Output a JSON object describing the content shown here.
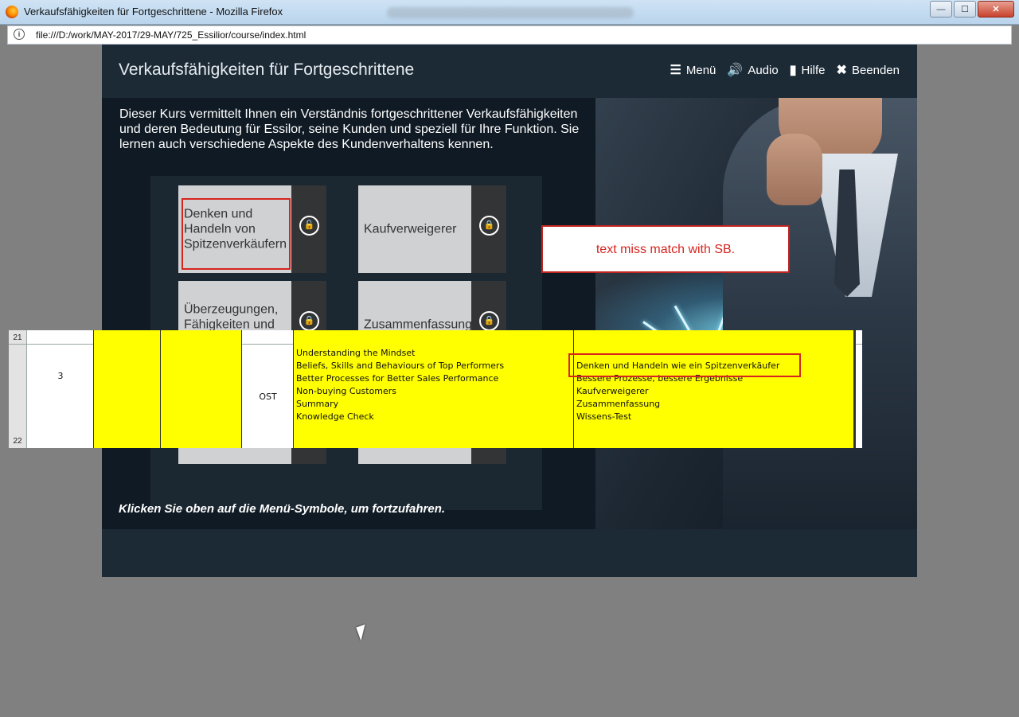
{
  "browser": {
    "title": "Verkaufsfähigkeiten für Fortgeschrittene - Mozilla Firefox",
    "url": "file:///D:/work/MAY-2017/29-MAY/725_Essilior/course/index.html",
    "window_buttons": {
      "minimize": "—",
      "maximize": "☐",
      "close": "✕"
    }
  },
  "course": {
    "title": "Verkaufsfähigkeiten für Fortgeschrittene",
    "nav": {
      "menu": {
        "label": "Menü",
        "icon": "menu-icon",
        "glyph": "☰"
      },
      "audio": {
        "label": "Audio",
        "icon": "speaker-icon",
        "glyph": "🔊"
      },
      "help": {
        "label": "Hilfe",
        "icon": "book-icon",
        "glyph": "▮"
      },
      "exit": {
        "label": "Beenden",
        "icon": "close-icon",
        "glyph": "✖"
      }
    },
    "intro": "Dieser Kurs vermittelt Ihnen ein Verständnis fortgeschrittener Verkaufsfähigkeiten und deren Bedeutung für Essilor, seine Kunden und speziell für Ihre Funktion. Sie lernen auch verschiedene Aspekte des Kundenverhaltens kennen.",
    "tiles": [
      {
        "label": "Denken und Handeln von Spitzenverkäufern",
        "lock": "unlocked"
      },
      {
        "label": "Kaufverweigerer",
        "lock": "locked"
      },
      {
        "label": "Überzeugungen, Fähigkeiten und Verhaltensweisen",
        "lock": "locked"
      },
      {
        "label": "Zusammenfassung",
        "lock": "locked"
      }
    ],
    "hint": "Klicken Sie oben auf die Menü-Symbole, um fortzufahren."
  },
  "callout": {
    "text": "text miss match with SB."
  },
  "sheet": {
    "row_numbers": [
      "21",
      "22"
    ],
    "number": "3",
    "code": "OST",
    "english": [
      "Understanding the Mindset",
      "Beliefs, Skills and Behaviours of Top Performers",
      "Better Processes for Better Sales Performance",
      "Non-buying Customers",
      "Summary",
      "Knowledge Check"
    ],
    "german": [
      "Denken und Handeln wie ein Spitzenverkäufer",
      "Bessere Prozesse, bessere Ergebnisse",
      "Kaufverweigerer",
      "Zusammenfassung",
      "Wissens-Test"
    ],
    "colors": {
      "highlight": "#ffff00",
      "annotation_red": "#d6251f"
    }
  }
}
